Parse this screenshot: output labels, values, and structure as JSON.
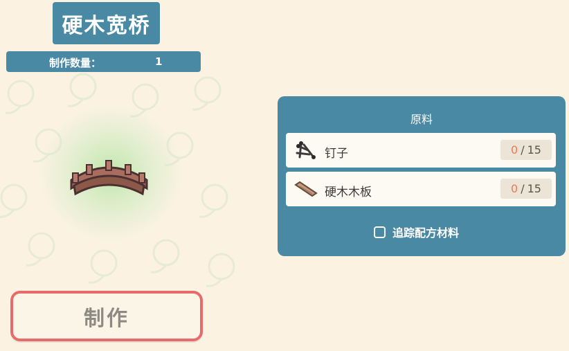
{
  "recipe": {
    "title": "硬木宽桥",
    "quantity_label": "制作数量：",
    "quantity_value": "1",
    "item_icon": "bridge-icon",
    "craft_label": "制作"
  },
  "materials_panel": {
    "title": "原料",
    "items": [
      {
        "name": "钉子",
        "icon": "nails-icon",
        "have": "0",
        "sep": "/",
        "need": "15"
      },
      {
        "name": "硬木木板",
        "icon": "plank-icon",
        "have": "0",
        "sep": "/",
        "need": "15"
      }
    ],
    "track_label": "追踪配方材料",
    "track_checked": false
  },
  "colors": {
    "panel": "#4a89a4",
    "background": "#fbf2e2",
    "craft_border": "#e96a6a",
    "have_count": "#e87a55"
  }
}
